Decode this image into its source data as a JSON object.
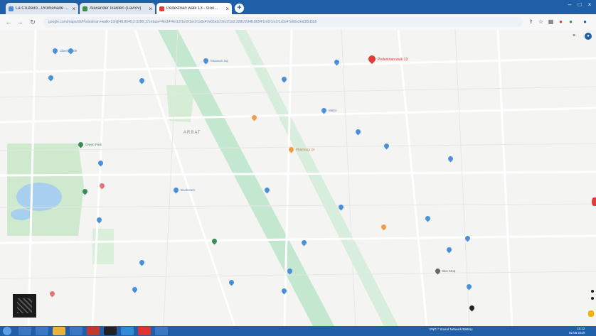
{
  "browser": {
    "tabs": [
      {
        "label": "La Cruzeiro...Promenade Coupe"
      },
      {
        "label": "Alexander Garden (Lavrov)"
      },
      {
        "label": "Pedestrian walk 13 - Goo..."
      }
    ],
    "new_tab_label": "+",
    "omnibox_value": "google.com/maps/dir/Pedestrian+walk+13/@48.8646,2.3290,17z/data=!4m14!4m13!1m5!1m1!1s0x47e66e2c!2m2!1d2.3281!2d48.8654!1m5!1m1!1s0x47e66e2ed3f5d5b5"
  },
  "map": {
    "destination_label": "Pedestrian walk 13",
    "district_label": "ARBAT",
    "pois": [
      {
        "label": "Liberty Cafe",
        "cls": ""
      },
      {
        "label": "Museum Sq.",
        "cls": ""
      },
      {
        "label": "Metro",
        "cls": ""
      },
      {
        "label": "Pharmacy 24",
        "cls": "orange"
      },
      {
        "label": "Green Park",
        "cls": "green"
      },
      {
        "label": "Bookstore",
        "cls": ""
      },
      {
        "label": "Bus Stop",
        "cls": "grey"
      }
    ]
  },
  "taskbar": {
    "tray_text": "ENG  ^  Sound  Network  Battery",
    "time": "15:12",
    "date": "02.05.2019"
  },
  "colors": {
    "accent": "#1f5fa8",
    "pin": "#e53935"
  }
}
